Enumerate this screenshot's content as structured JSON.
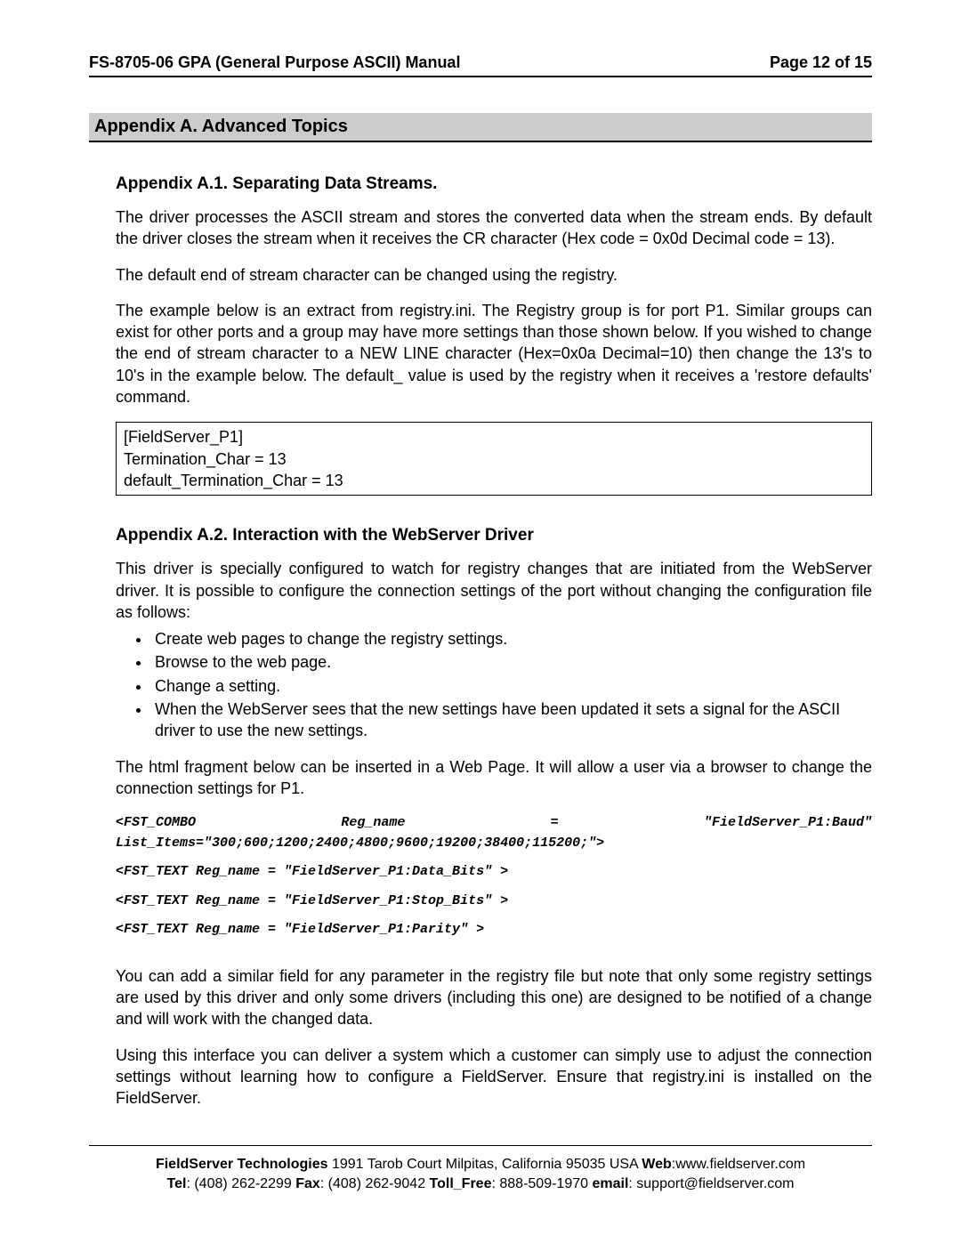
{
  "header": {
    "title": "FS-8705-06 GPA (General Purpose ASCII) Manual",
    "page": "Page 12 of 15"
  },
  "appendix": {
    "title": "Appendix A. Advanced Topics"
  },
  "sectionA1": {
    "title": "Appendix A.1.   Separating Data Streams.",
    "para1": "The driver processes the ASCII stream and stores the converted data when the stream ends.  By default the driver closes the stream when it receives the CR character (Hex code = 0x0d Decimal code = 13).",
    "para2": "The default end of stream character can be changed using the registry.",
    "para3": "The example below is an extract from registry.ini.  The Registry group is for port P1.  Similar groups can exist for other ports and a group may have more settings than those shown below.  If you wished to change the end of stream character to a NEW LINE character (Hex=0x0a Decimal=10) then change the 13's to 10's in the example below.  The default_ value is used by the registry when it receives a 'restore defaults' command.",
    "code1": "[FieldServer_P1]",
    "code2": "Termination_Char = 13",
    "code3": "default_Termination_Char = 13"
  },
  "sectionA2": {
    "title": "Appendix A.2.   Interaction with the WebServer Driver",
    "para1": "This driver is specially configured to watch for registry changes that are initiated from the WebServer driver.  It is possible to configure the connection settings of the port without changing the configuration file as follows:",
    "bullets": {
      "b1": "Create web pages to change the registry settings.",
      "b2": "Browse to the web page.",
      "b3": "Change a setting.",
      "b4": "When the WebServer sees that the new settings have been updated it sets a signal for the ASCII driver to use the new settings."
    },
    "para2": "The html fragment below can be inserted in a Web Page. It will allow a user via a browser to change the connection settings for P1.",
    "code": {
      "combo_a": "<FST_COMBO",
      "combo_b": "Reg_name",
      "combo_c": "=",
      "combo_d": "\"FieldServer_P1:Baud\"",
      "combo_list": "List_Items=\"300;600;1200;2400;4800;9600;19200;38400;115200;\">",
      "line2": "<FST_TEXT Reg_name = \"FieldServer_P1:Data_Bits\" >",
      "line3": "<FST_TEXT Reg_name = \"FieldServer_P1:Stop_Bits\" >",
      "line4": "<FST_TEXT Reg_name = \"FieldServer_P1:Parity\" >"
    },
    "para3": "You can add a similar field for any parameter in the registry file but note that only some registry settings are used by this driver and only some drivers (including this one) are designed to be notified of a change and will work with the changed data.",
    "para4": "Using this interface you can deliver a system which a customer can simply use to adjust the connection settings without learning how to configure a FieldServer.  Ensure that registry.ini is installed on the FieldServer."
  },
  "footer": {
    "company": "FieldServer Technologies",
    "address": " 1991 Tarob Court Milpitas, California 95035 USA  ",
    "web_label": "Web",
    "web": ":www.fieldserver.com",
    "tel_label": "Tel",
    "tel": ": (408) 262-2299   ",
    "fax_label": "Fax",
    "fax": ": (408) 262-9042   ",
    "toll_label": "Toll_Free",
    "toll": ": 888-509-1970   ",
    "email_label": "email",
    "email": ": support@fieldserver.com"
  }
}
